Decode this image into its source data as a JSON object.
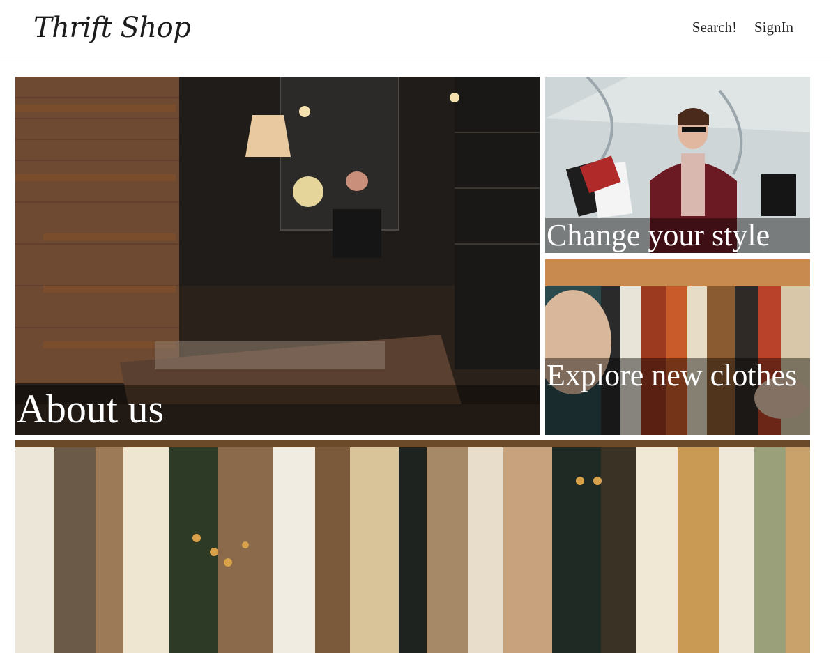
{
  "header": {
    "logo": "Thrift Shop",
    "nav": [
      {
        "label": "Search!"
      },
      {
        "label": "SignIn"
      }
    ]
  },
  "tiles": {
    "about": {
      "caption": "About us"
    },
    "style": {
      "caption": "Change your style"
    },
    "explore": {
      "caption": "Explore new clothes"
    },
    "rack": {
      "caption": ""
    }
  }
}
